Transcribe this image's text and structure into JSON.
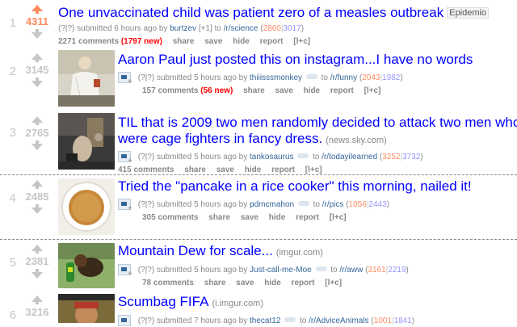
{
  "posts": [
    {
      "rank": "1",
      "score": "4311",
      "upvoted": true,
      "title": "One unvaccinated child was patient zero of a measles outbreak",
      "flair": "Epidemio",
      "domain": "",
      "submitted_prefix": "submitted 6 hours ago by",
      "author": "burtzev",
      "author_extra": "[+1]",
      "to_text": "to",
      "subreddit": "/r/science",
      "ups": "2860",
      "downs": "3017",
      "comments": "2271 comments",
      "new_comments": "(1797 new)",
      "actions": [
        "share",
        "save",
        "hide",
        "report",
        "[l+c]"
      ],
      "thumbnail": "none"
    },
    {
      "rank": "2",
      "score": "3145",
      "upvoted": false,
      "title": "Aaron Paul just posted this on instagram...I have no words",
      "flair": "",
      "domain": "",
      "submitted_prefix": "submitted 5 hours ago by",
      "author": "thiiisssmonkey",
      "author_extra": "",
      "to_text": "to",
      "subreddit": "/r/funny",
      "ups": "2043",
      "downs": "1982",
      "comments": "157 comments",
      "new_comments": "(56 new)",
      "actions": [
        "share",
        "save",
        "hide",
        "report",
        "[l+c]"
      ],
      "thumbnail": "photo-man"
    },
    {
      "rank": "3",
      "score": "2765",
      "upvoted": false,
      "title": "TIL that is 2009 two men randomly decided to attack two men who were cage fighters in fancy dress.",
      "flair": "",
      "domain": "(news.sky.com)",
      "submitted_prefix": "submitted 5 hours ago by",
      "author": "tankosaurus",
      "author_extra": "",
      "to_text": "to",
      "subreddit": "/r/todayilearned",
      "ups": "3252",
      "downs": "3732",
      "comments": "415 comments",
      "new_comments": "",
      "actions": [
        "share",
        "save",
        "hide",
        "report",
        "[l+c]"
      ],
      "thumbnail": "photo-street"
    },
    {
      "rank": "4",
      "score": "2485",
      "upvoted": false,
      "title": "Tried the \"pancake in a rice cooker\" this morning, nailed it!",
      "flair": "",
      "domain": "",
      "submitted_prefix": "submitted 5 hours ago by",
      "author": "pdmcmahon",
      "author_extra": "",
      "to_text": "to",
      "subreddit": "/r/pics",
      "ups": "1056",
      "downs": "2443",
      "comments": "305 comments",
      "new_comments": "",
      "actions": [
        "share",
        "save",
        "hide",
        "report",
        "[l+c]"
      ],
      "thumbnail": "photo-pancake"
    },
    {
      "rank": "5",
      "score": "2381",
      "upvoted": false,
      "title": "Mountain Dew for scale...",
      "flair": "",
      "domain": "(imgur.com)",
      "submitted_prefix": "submitted 5 hours ago by",
      "author": "Just-call-me-Moe",
      "author_extra": "",
      "to_text": "to",
      "subreddit": "/r/aww",
      "ups": "3161",
      "downs": "2219",
      "comments": "78 comments",
      "new_comments": "",
      "actions": [
        "share",
        "save",
        "hide",
        "report",
        "[l+c]"
      ],
      "thumbnail": "photo-dog"
    },
    {
      "rank": "6",
      "score": "3216",
      "upvoted": false,
      "title": "Scumbag FIFA",
      "flair": "",
      "domain": "(i.imgur.com)",
      "submitted_prefix": "submitted 7 hours ago by",
      "author": "thecat12",
      "author_extra": "",
      "to_text": "to",
      "subreddit": "/r/AdviceAnimals",
      "ups": "1001",
      "downs": "1841",
      "comments": "",
      "new_comments": "",
      "actions": [],
      "thumbnail": "photo-meme"
    }
  ],
  "tagline_qm": "(?|?)",
  "colors": {
    "link": "#0000ff",
    "upvote": "#ff8b60",
    "downvote": "#9494ff",
    "new": "#ff0000"
  }
}
